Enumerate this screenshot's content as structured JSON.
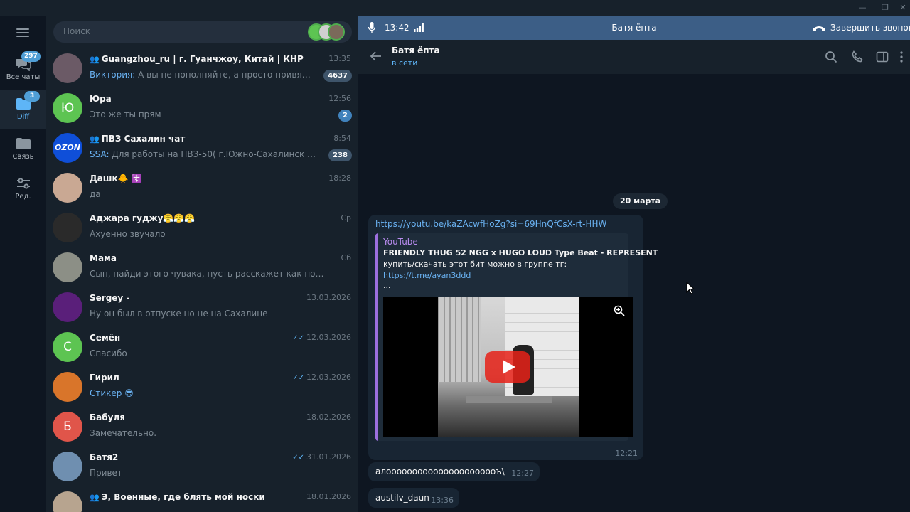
{
  "window": {
    "minimize": "—",
    "restore": "❐",
    "close": "✕"
  },
  "rail": {
    "folders": [
      {
        "label": "Все чаты",
        "badge": "297",
        "icon": "chat-bubbles-icon",
        "active": false
      },
      {
        "label": "Diff",
        "badge": "3",
        "icon": "folder-icon",
        "active": true
      },
      {
        "label": "Связь",
        "badge": "",
        "icon": "folder-icon",
        "active": false
      },
      {
        "label": "Ред.",
        "badge": "",
        "icon": "sliders-icon",
        "active": false
      }
    ]
  },
  "search": {
    "placeholder": "Поиск"
  },
  "chats": [
    {
      "name": "Guangzhou_ru | г. Гуанчжоу, Китай | КНР",
      "group": true,
      "time": "13:35",
      "sender": "Виктория",
      "preview": "А вы не пополняйте, а просто привяжите кар...",
      "badge": "4637",
      "badge_style": "muted",
      "avatar_letter": "",
      "avatar_color": "#6b5a66",
      "read": false
    },
    {
      "name": "Юра",
      "group": false,
      "time": "12:56",
      "sender": "",
      "preview": "Это же ты прям",
      "badge": "2",
      "badge_style": "blue",
      "avatar_letter": "Ю",
      "avatar_color": "#5dc452",
      "read": false
    },
    {
      "name": "ПВЗ Сахалин чат",
      "group": true,
      "time": "8:54",
      "sender": "SSA",
      "preview": "Для работы на ПВЗ-50( г.Южно-Сахалинск ул.Емелья...",
      "badge": "238",
      "badge_style": "muted",
      "avatar_letter": "OZON",
      "avatar_color": "#0f4fd9",
      "read": false
    },
    {
      "name": "Дашк🐥 ☦️",
      "group": false,
      "time": "18:28",
      "sender": "",
      "preview": "да",
      "badge": "",
      "badge_style": "",
      "avatar_letter": "",
      "avatar_color": "#c9a893",
      "read": false
    },
    {
      "name": "Аджара гуджу😤😤😤",
      "group": false,
      "time": "Ср",
      "sender": "",
      "preview": "Ахуенно звучало",
      "badge": "",
      "badge_style": "",
      "avatar_letter": "",
      "avatar_color": "#2a2a2a",
      "read": false
    },
    {
      "name": "Мама",
      "group": false,
      "time": "Сб",
      "sender": "",
      "preview": "Сын, найди этого чувака, пусть расскажет как поступил. Я дума...",
      "badge": "",
      "badge_style": "",
      "avatar_letter": "",
      "avatar_color": "#8c8f86",
      "read": false
    },
    {
      "name": "Sergey -",
      "group": false,
      "time": "13.03.2026",
      "sender": "",
      "preview": "Ну он был в отпуске но не на Сахалине",
      "badge": "",
      "badge_style": "",
      "avatar_letter": "",
      "avatar_color": "#5a1f7a",
      "read": false
    },
    {
      "name": "Семён",
      "group": false,
      "time": "12.03.2026",
      "sender": "",
      "preview": "Спасибо",
      "badge": "",
      "badge_style": "",
      "avatar_letter": "С",
      "avatar_color": "#5dc452",
      "read": true
    },
    {
      "name": "Гирил",
      "group": false,
      "time": "12.03.2026",
      "sender": "",
      "preview": "Стикер 😎",
      "badge": "",
      "badge_style": "",
      "avatar_letter": "",
      "avatar_color": "#d9752a",
      "read": true,
      "preview_blue": true
    },
    {
      "name": "Бабуля",
      "group": false,
      "time": "18.02.2026",
      "sender": "",
      "preview": "Замечательно.",
      "badge": "",
      "badge_style": "",
      "avatar_letter": "Б",
      "avatar_color": "#e0554a",
      "read": false
    },
    {
      "name": "Батя2",
      "group": false,
      "time": "31.01.2026",
      "sender": "",
      "preview": "Привет",
      "badge": "",
      "badge_style": "",
      "avatar_letter": "",
      "avatar_color": "#6f8fb0",
      "read": true
    },
    {
      "name": "Э, Военные, где блять мой носки",
      "group": true,
      "time": "18.01.2026",
      "sender": "",
      "preview": "",
      "badge": "",
      "badge_style": "",
      "avatar_letter": "",
      "avatar_color": "#b7a48f",
      "read": false
    }
  ],
  "call": {
    "time": "13:42",
    "name": "Батя ёпта",
    "end_label": "Завершить звонок"
  },
  "header": {
    "name": "Батя ёпта",
    "status": "в сети"
  },
  "messages": {
    "date": "20 марта",
    "link_msg": {
      "url": "https://youtu.be/kaZAcwfHoZg?si=69HnQfCsX-rt-HHW",
      "site": "YouTube",
      "title": "FRIENDLY THUG 52 NGG x HUGO LOUD Type Beat - REPRESENT",
      "desc": "купить/скачать этот бит можно в группе тг:",
      "desc_link": "https://t.me/ayan3ddd",
      "more": "...",
      "time": "12:21"
    },
    "msg2": {
      "text": "алоооооооооооооооооооооъ\\",
      "time": "12:27"
    },
    "msg3": {
      "text": "austilv_daun",
      "time": "13:36"
    }
  },
  "colors": {
    "accent": "#5eb5f7",
    "panel": "#17212b",
    "bg": "#0e1621",
    "call_bar": "#3c5e86",
    "youtube_red": "#e62117"
  }
}
